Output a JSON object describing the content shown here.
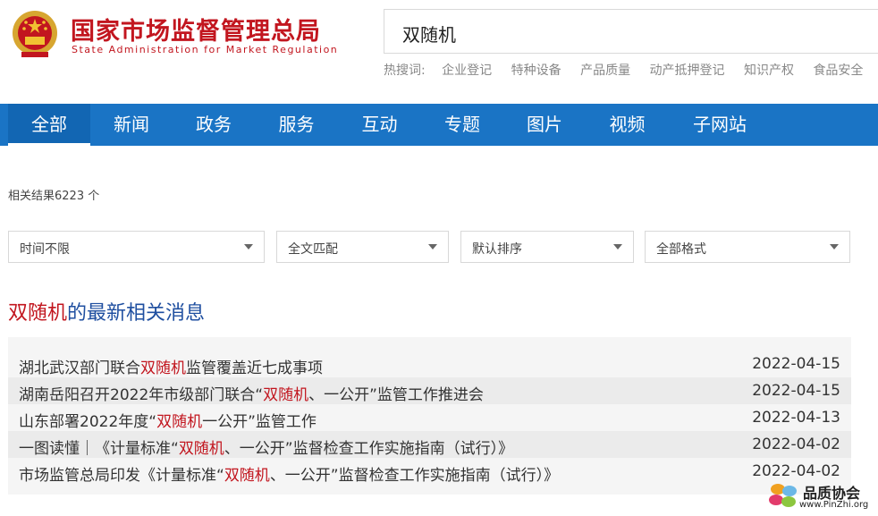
{
  "header": {
    "title": "国家市场监督管理总局",
    "subtitle": "State Administration for Market Regulation",
    "search_value": "双随机",
    "hot_label": "热搜词:",
    "hot_words": [
      "企业登记",
      "特种设备",
      "产品质量",
      "动产抵押登记",
      "知识产权",
      "食品安全"
    ]
  },
  "nav": {
    "items": [
      "全部",
      "新闻",
      "政务",
      "服务",
      "互动",
      "专题",
      "图片",
      "视频",
      "子网站"
    ],
    "active": "全部"
  },
  "results": {
    "count_text": "相关结果6223 个"
  },
  "filters": [
    "时间不限",
    "全文匹配",
    "默认排序",
    "全部格式"
  ],
  "latest": {
    "keyword": "双随机",
    "suffix": "的最新相关消息",
    "items": [
      {
        "pre": "湖北武汉部门联合",
        "kw": "双随机",
        "post": "监管覆盖近七成事项",
        "date": "2022-04-15"
      },
      {
        "pre": "湖南岳阳召开2022年市级部门联合“",
        "kw": "双随机",
        "post": "、一公开”监管工作推进会",
        "date": "2022-04-15"
      },
      {
        "pre": "山东部署2022年度“",
        "kw": "双随机",
        "post": "一公开”监管工作",
        "date": "2022-04-13"
      },
      {
        "pre": "一图读懂｜《计量标准“",
        "kw": "双随机",
        "post": "、一公开”监督检查工作实施指南（试行）》",
        "date": "2022-04-02"
      },
      {
        "pre": "市场监管总局印发《计量标准“",
        "kw": "双随机",
        "post": "、一公开”监督检查工作实施指南（试行）》",
        "date": "2022-04-02"
      }
    ]
  },
  "watermark": {
    "name": "品质协会",
    "url": "www.PinZhi.org"
  },
  "colors": {
    "brand_red": "#c2161f",
    "nav_blue": "#1a74c5",
    "title_blue": "#1f4fa0"
  }
}
